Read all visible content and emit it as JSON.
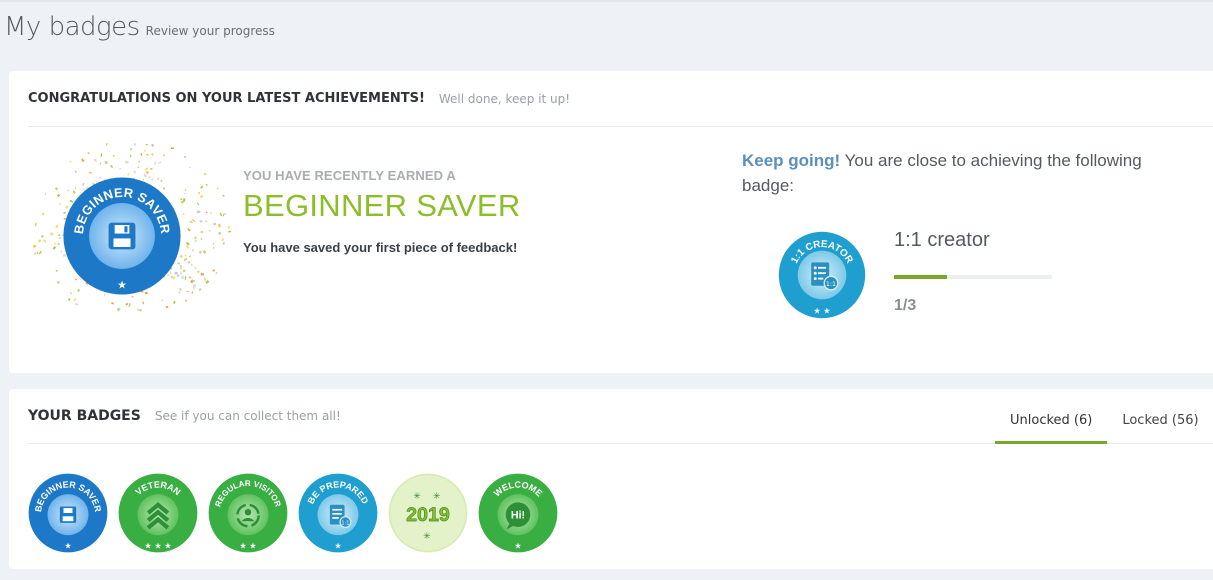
{
  "header": {
    "title": "My badges",
    "subtitle": "Review your progress"
  },
  "achievements": {
    "title": "CONGRATULATIONS ON YOUR LATEST ACHIEVEMENTS!",
    "hint": "Well done, keep it up!",
    "earned": {
      "pre": "YOU HAVE RECENTLY EARNED A",
      "name": "BEGINNER SAVER",
      "description": "You have saved your first piece of feedback!",
      "badge_text": "BEGINNER SAVER",
      "icon": "floppy-disk-icon",
      "stars": 1
    },
    "next": {
      "lead_strong": "Keep going!",
      "lead_rest": "You are close to achieving the following badge:",
      "name": "1:1 creator",
      "badge_text": "1:1 CREATOR",
      "icon": "one-on-one-form-icon",
      "stars": 2,
      "progress_text": "1/3",
      "progress_fraction": 0.3333
    }
  },
  "badges": {
    "title": "YOUR BADGES",
    "hint": "See if you can collect them all!",
    "tabs": [
      {
        "label": "Unlocked (6)",
        "active": true
      },
      {
        "label": "Locked (56)",
        "active": false
      }
    ],
    "items": [
      {
        "text": "BEGINNER SAVER",
        "icon": "floppy-disk-icon",
        "stars": 1,
        "color": "#1e78c8"
      },
      {
        "text": "VETERAN",
        "icon": "chevron-rank-icon",
        "stars": 3,
        "color": "#39ae43"
      },
      {
        "text": "REGULAR VISITOR",
        "icon": "user-cycle-icon",
        "stars": 2,
        "color": "#39ae43"
      },
      {
        "text": "BE PREPARED",
        "icon": "one-on-one-form-icon",
        "stars": 1,
        "color": "#1f9ed0"
      },
      {
        "text": "2019",
        "icon": "year-2019-icon",
        "stars": 0,
        "color": "#d6ebb2"
      },
      {
        "text": "WELCOME",
        "icon": "hi-speech-bubble-icon",
        "stars": 1,
        "color": "#39ae43"
      }
    ]
  },
  "colors": {
    "accent_green": "#8cbd2a",
    "progress_green": "#76a92a",
    "link_blue": "#5b8fbf",
    "badge_blue": "#1e78c8",
    "badge_green": "#39ae43",
    "badge_teal": "#1f9ed0"
  }
}
